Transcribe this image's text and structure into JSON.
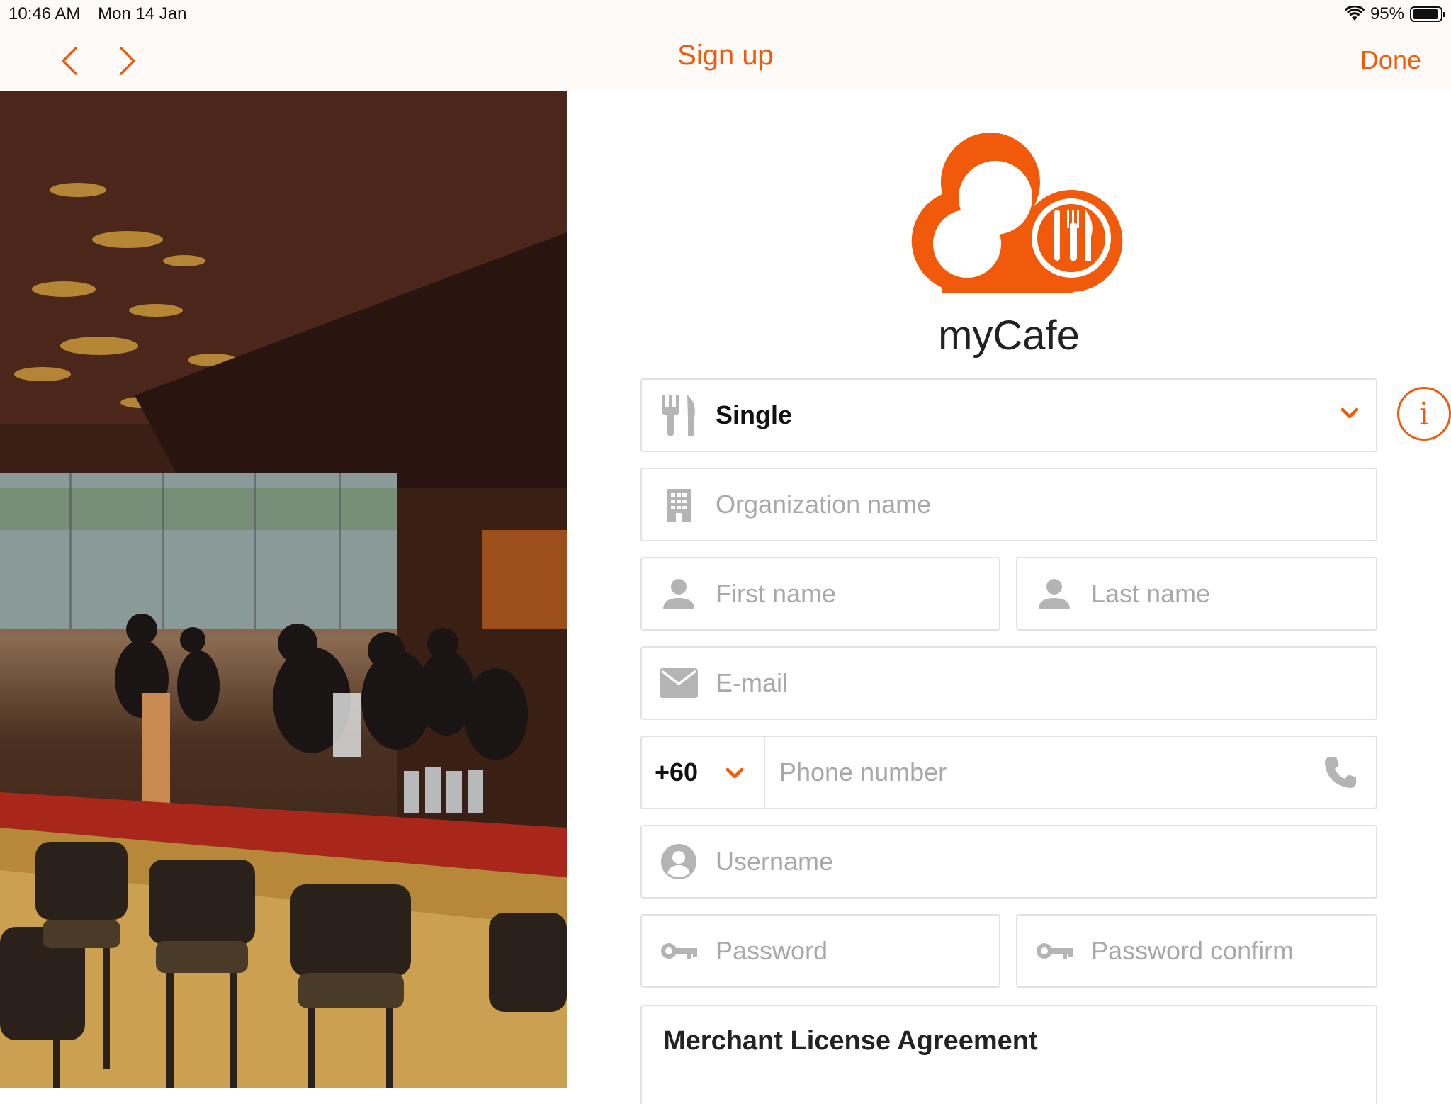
{
  "status": {
    "time": "10:46 AM",
    "date": "Mon 14 Jan",
    "battery": "95%",
    "battery_level": 0.95
  },
  "nav": {
    "title": "Sign up",
    "done_label": "Done"
  },
  "app": {
    "name": "myCafe"
  },
  "form": {
    "business_type": "Single",
    "organization_placeholder": "Organization name",
    "first_name_placeholder": "First name",
    "last_name_placeholder": "Last name",
    "email_placeholder": "E-mail",
    "country_code": "+60",
    "phone_placeholder": "Phone number",
    "username_placeholder": "Username",
    "password_placeholder": "Password",
    "password_confirm_placeholder": "Password confirm"
  },
  "license": {
    "title": "Merchant License Agreement"
  },
  "colors": {
    "accent": "#f05a0a",
    "icon_gray": "#b4b4b4",
    "border": "#e2e2e2"
  }
}
